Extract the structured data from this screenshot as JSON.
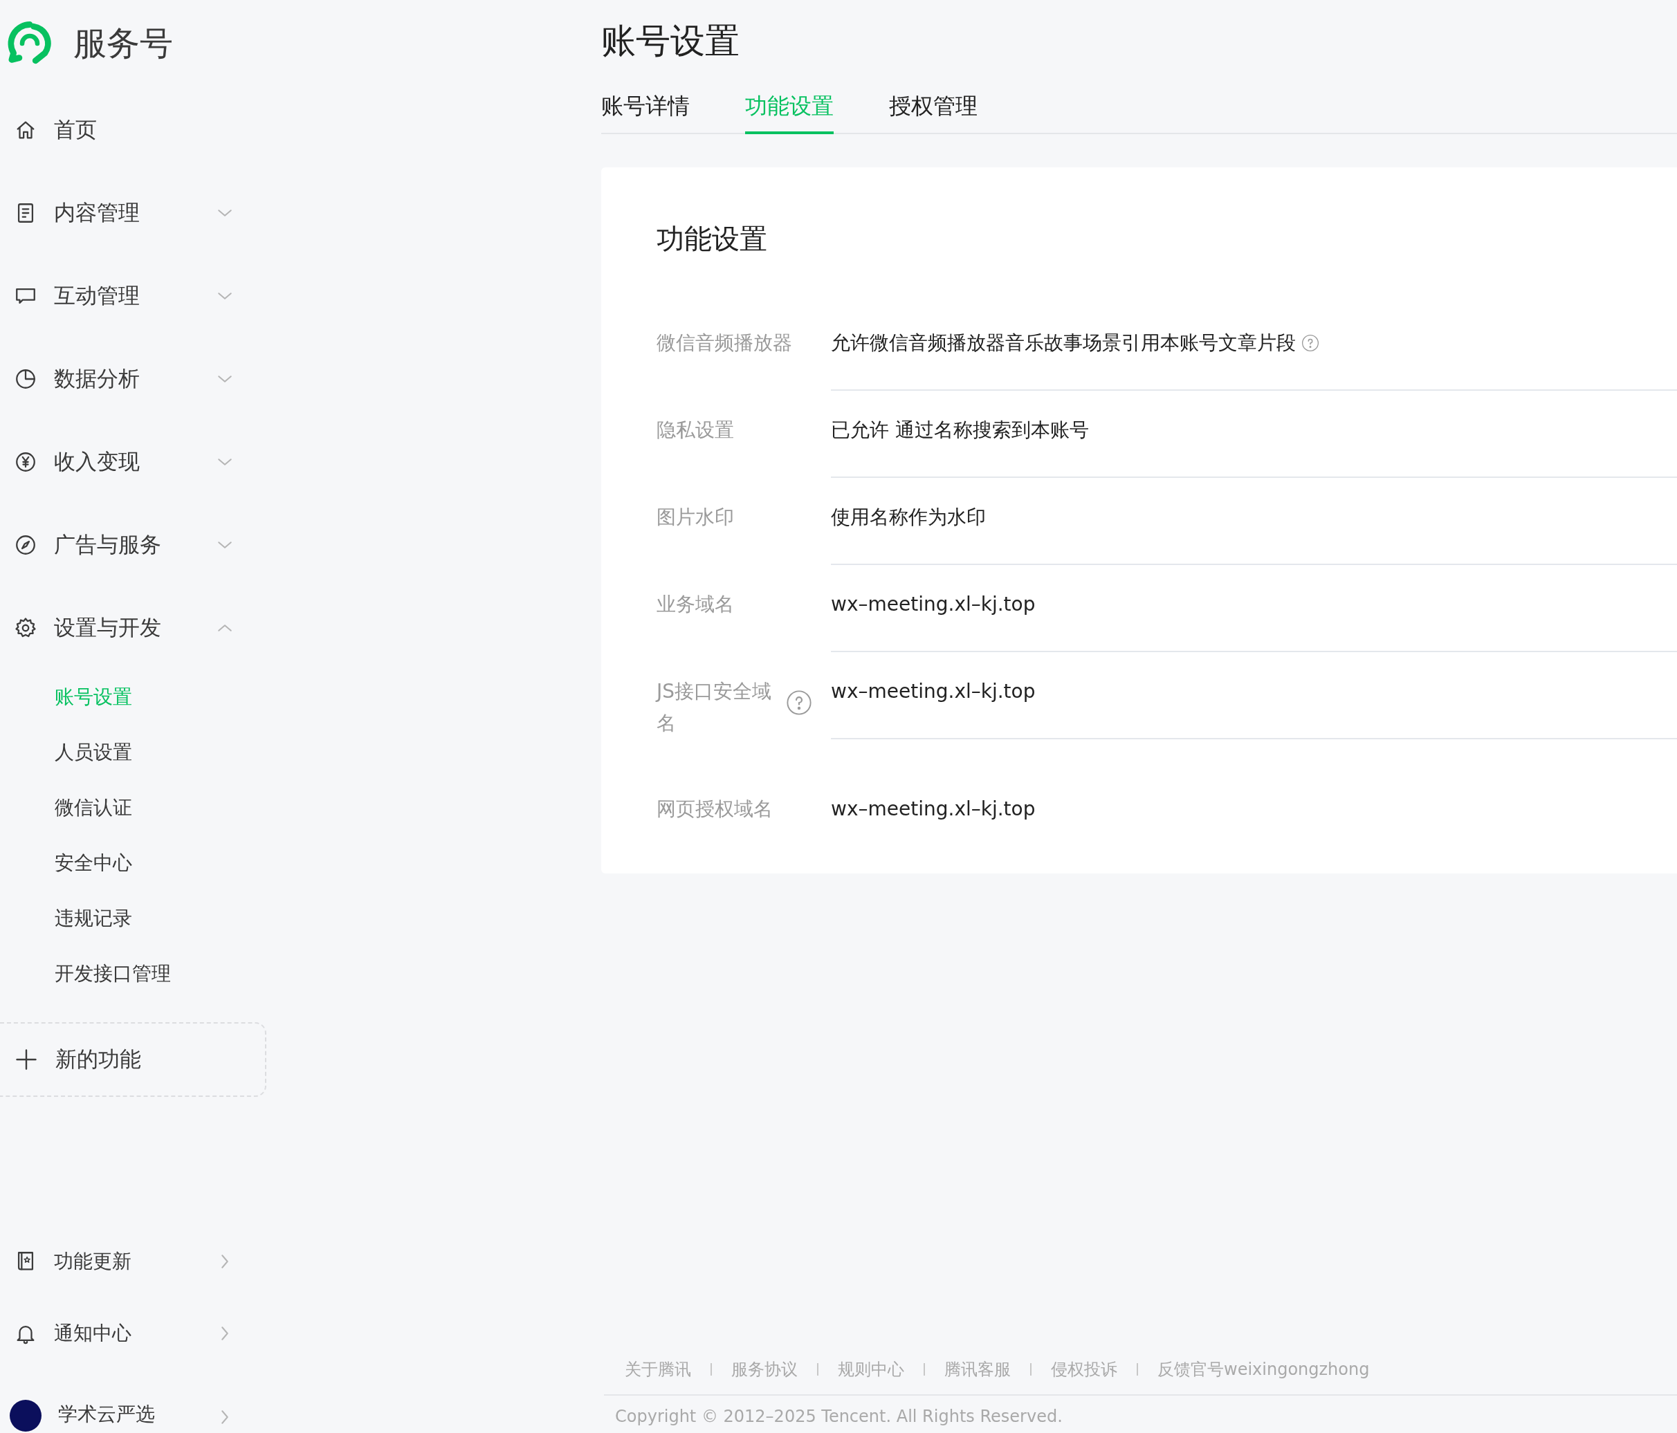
{
  "app": {
    "name": "服务号"
  },
  "sidebar": {
    "items": [
      {
        "kind": "link",
        "label": "首页"
      },
      {
        "kind": "group",
        "label": "内容管理",
        "expanded": false
      },
      {
        "kind": "group",
        "label": "互动管理",
        "expanded": false
      },
      {
        "kind": "group",
        "label": "数据分析",
        "expanded": false
      },
      {
        "kind": "group",
        "label": "收入变现",
        "expanded": false
      },
      {
        "kind": "group",
        "label": "广告与服务",
        "expanded": false
      },
      {
        "kind": "group",
        "label": "设置与开发",
        "expanded": true,
        "children": [
          {
            "label": "账号设置",
            "selected": true
          },
          {
            "label": "人员设置",
            "selected": false
          },
          {
            "label": "微信认证",
            "selected": false
          },
          {
            "label": "安全中心",
            "selected": false
          },
          {
            "label": "违规记录",
            "selected": false
          },
          {
            "label": "开发接口管理",
            "selected": false
          }
        ]
      }
    ],
    "new_feature": {
      "label": "新的功能"
    },
    "bottom_items": [
      {
        "kind": "link",
        "label": "功能更新"
      },
      {
        "kind": "link",
        "label": "通知中心"
      },
      {
        "kind": "account",
        "label": "学术云严选"
      }
    ]
  },
  "page": {
    "title": "账号设置",
    "tabs": [
      {
        "label": "账号详情",
        "selected": false
      },
      {
        "label": "功能设置",
        "selected": true
      },
      {
        "label": "授权管理",
        "selected": false
      }
    ],
    "card": {
      "title": "功能设置",
      "rows": [
        {
          "label": "微信音频播放器",
          "label_help": false,
          "value": "允许微信音频播放器音乐故事场景引用本账号文章片段",
          "value_help": true
        },
        {
          "label": "隐私设置",
          "label_help": false,
          "value": "已允许 通过名称搜索到本账号",
          "value_help": false
        },
        {
          "label": "图片水印",
          "label_help": false,
          "value": "使用名称作为水印",
          "value_help": false
        },
        {
          "label": "业务域名",
          "label_help": false,
          "value": "wx–meeting.xl–kj.top",
          "value_help": false
        },
        {
          "label": "JS接口安全域名",
          "label_help": true,
          "value": "wx–meeting.xl–kj.top",
          "value_help": false
        },
        {
          "label": "网页授权域名",
          "label_help": false,
          "value": "wx–meeting.xl–kj.top",
          "value_help": false
        }
      ]
    }
  },
  "footer": {
    "links": [
      "关于腾讯",
      "服务协议",
      "规则中心",
      "腾讯客服",
      "侵权投诉",
      "反馈官号weixingongzhong"
    ],
    "copyright": "Copyright © 2012–2025 Tencent. All Rights Reserved."
  }
}
